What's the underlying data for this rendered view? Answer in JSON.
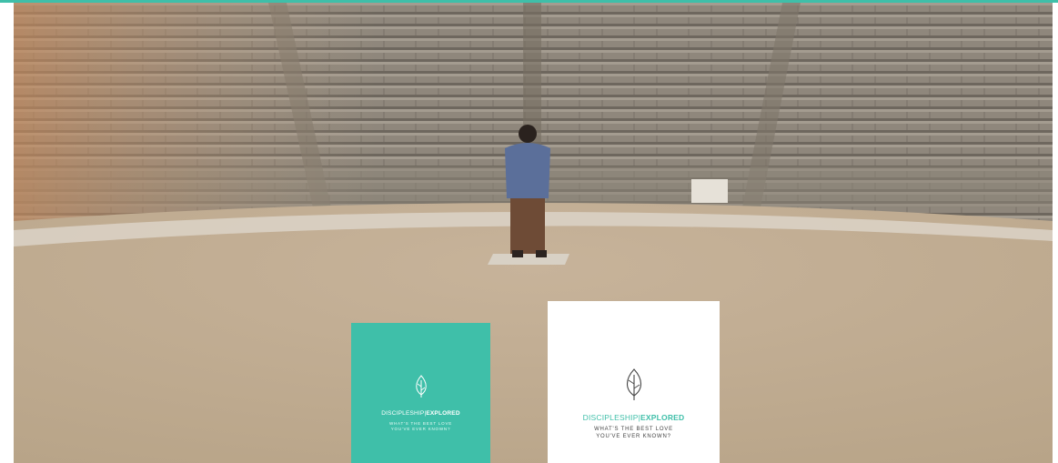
{
  "page": {
    "accent_color": "#3fbfa9"
  },
  "hero": {
    "image_description": "A man standing alone in the center of an ancient stone amphitheater",
    "icon": "amphitheater-photo"
  },
  "books": [
    {
      "brand_part1": "DISCIPLESHIP|",
      "brand_part2": "EXPLORED",
      "tagline_line1": "WHAT'S THE BEST LOVE",
      "tagline_line2": "YOU'VE EVER KNOWN?",
      "cover_color": "#3fbfa9",
      "icon": "leaf-icon"
    },
    {
      "brand_part1": "DISCIPLESHIP|",
      "brand_part2": "EXPLORED",
      "tagline_line1": "WHAT'S THE BEST LOVE",
      "tagline_line2": "YOU'VE EVER KNOWN?",
      "cover_color": "#ffffff",
      "icon": "leaf-icon"
    }
  ]
}
